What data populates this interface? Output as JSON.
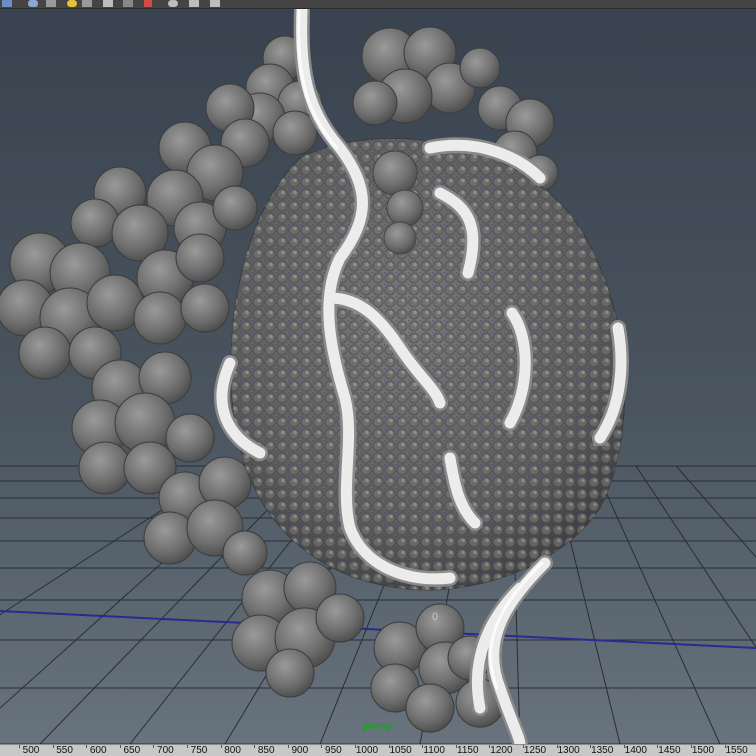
{
  "camera_label": "persp",
  "grid_origin_label": "0",
  "timeline_ticks": [
    "500",
    "550",
    "600",
    "650",
    "700",
    "750",
    "800",
    "850",
    "900",
    "950",
    "1000",
    "1050",
    "1100",
    "1150",
    "1200",
    "1250",
    "1300",
    "1350",
    "1400",
    "1450",
    "1500",
    "1550"
  ],
  "toolbar_icons": [
    "select-tool-icon",
    "lasso-tool-icon",
    "paint-tool-icon",
    "move-tool-icon",
    "rotate-tool-icon",
    "scale-tool-icon",
    "manipulator-icon",
    "soft-mod-icon",
    "show-manipulator-icon",
    "last-tool-icon"
  ],
  "colors": {
    "background_top": "#3a4450",
    "background_bottom": "#5f6b76",
    "grid_line": "#26303a",
    "axis_blue": "#2a2a8f",
    "molecule": "#767676",
    "tube": "#e6e6e6",
    "camera_label": "#1aa31a"
  }
}
